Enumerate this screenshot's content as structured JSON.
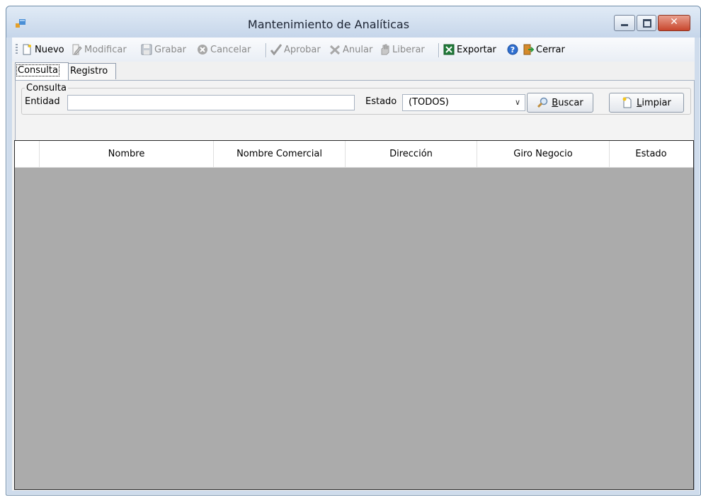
{
  "window": {
    "title": "Mantenimiento de Analíticas",
    "close_glyph": "✕"
  },
  "toolbar": {
    "nuevo": "Nuevo",
    "modificar": "Modificar",
    "grabar": "Grabar",
    "cancelar": "Cancelar",
    "aprobar": "Aprobar",
    "anular": "Anular",
    "liberar": "Liberar",
    "exportar": "Exportar",
    "cerrar": "Cerrar"
  },
  "tabs": [
    {
      "label": "Consulta",
      "active": true
    },
    {
      "label": "Registro",
      "active": false
    }
  ],
  "filter": {
    "group_title": "Consulta",
    "entidad_label": "Entidad",
    "entidad_value": "",
    "estado_label": "Estado",
    "estado_value": "(TODOS)",
    "buscar_label": "uscar",
    "buscar_mnemonic": "B",
    "limpiar_label": "impiar",
    "limpiar_mnemonic": "L"
  },
  "grid": {
    "columns": [
      "Nombre",
      "Nombre Comercial",
      "Dirección",
      "Giro Negocio",
      "Estado"
    ],
    "rows": []
  },
  "colors": {
    "grid_background": "#ababab",
    "close_button": "#c8462d"
  }
}
